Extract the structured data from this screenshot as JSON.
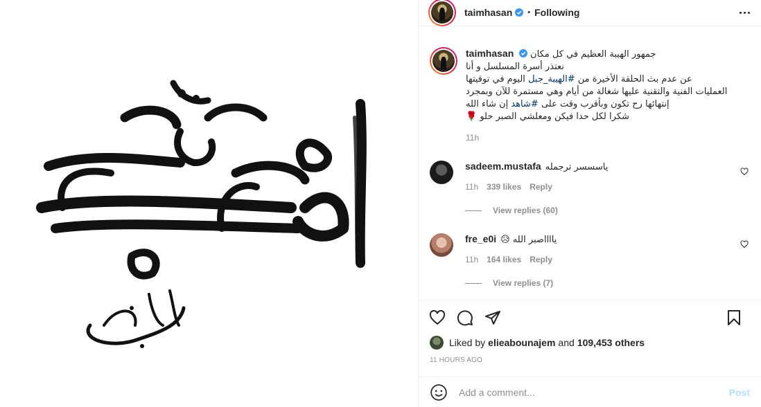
{
  "post": {
    "username": "taimhasan",
    "follow_status": "Following",
    "separator": "•",
    "caption": {
      "username": "taimhasan",
      "line1": "جمهور الهيبة العظيم في كل مكان",
      "line2": "نعتذر أسرة المسلسل و أنا",
      "line3_a": "عن عدم بث الحلقة الأخيرة من ",
      "line3_tag": "#الهيبة_جبل",
      "line3_b": " اليوم في توقيتها",
      "line4": "العمليات الفنية والتقنية عليها شغالة من أيام وهي مستمرة للآن وبمجرد",
      "line5_a": "إنتهائها رح تكون وبأقرب وقت على ",
      "line5_tag": "#شاهد",
      "line5_b": " إن شاء الله",
      "line6": "شكرا لكل حدا فيكن ومعلشي الصبر حلو 🌹",
      "time": "11h"
    },
    "comments": [
      {
        "username": "sadeem.mustafa",
        "text": "ياسسسر ترجمله",
        "time": "11h",
        "likes": "339 likes",
        "reply": "Reply",
        "view_replies": "View replies (60)"
      },
      {
        "username": "fre_e0i",
        "text": "يااااصبر الله 😥",
        "time": "11h",
        "likes": "164 likes",
        "reply": "Reply",
        "view_replies": "View replies (7)"
      }
    ],
    "liked_by_prefix": "Liked by ",
    "liked_by_user": "elieabounajem",
    "liked_by_and": " and ",
    "liked_by_others": "109,453 others",
    "time_ago": "11 HOURS AGO",
    "add_comment_placeholder": "Add a comment...",
    "post_button": "Post"
  },
  "artwork": {
    "title_ar": "الهيبة",
    "subtitle_ar": "جبل"
  },
  "colors": {
    "link": "#00376b",
    "muted": "#8e8e8e",
    "post_disabled": "#b2dffc",
    "verified": "#3897f0"
  }
}
